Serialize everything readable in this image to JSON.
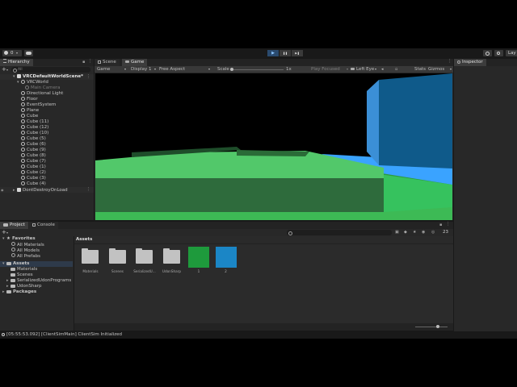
{
  "toolbar": {
    "account_label": "0",
    "layout_label": "Lay",
    "play_icon": "▶",
    "pause_icon": "❚❚",
    "step_icon": "▶❚"
  },
  "hierarchy": {
    "tab_label": "Hierarchy",
    "search_placeholder": "All",
    "scene_name": "VRCDefaultWorldScene*",
    "items": [
      {
        "label": "VRCWorld",
        "depth": 1,
        "expanded": true
      },
      {
        "label": "Main Camera",
        "depth": 2,
        "dimmed": true
      },
      {
        "label": "Directional Light",
        "depth": 1
      },
      {
        "label": "Floor",
        "depth": 1
      },
      {
        "label": "EventSystem",
        "depth": 1
      },
      {
        "label": "Plane",
        "depth": 1
      },
      {
        "label": "Cube",
        "depth": 1
      },
      {
        "label": "Cube (11)",
        "depth": 1
      },
      {
        "label": "Cube (12)",
        "depth": 1
      },
      {
        "label": "Cube (10)",
        "depth": 1
      },
      {
        "label": "Cube (5)",
        "depth": 1
      },
      {
        "label": "Cube (6)",
        "depth": 1
      },
      {
        "label": "Cube (9)",
        "depth": 1
      },
      {
        "label": "Cube (8)",
        "depth": 1
      },
      {
        "label": "Cube (7)",
        "depth": 1
      },
      {
        "label": "Cube (1)",
        "depth": 1
      },
      {
        "label": "Cube (2)",
        "depth": 1
      },
      {
        "label": "Cube (3)",
        "depth": 1
      },
      {
        "label": "Cube (4)",
        "depth": 1
      }
    ],
    "dont_destroy": "DontDestroyOnLoad"
  },
  "scene_tabs": {
    "scene": "Scene",
    "game": "Game"
  },
  "game_toolbar": {
    "mode": "Game",
    "display": "Display 1",
    "aspect": "Free Aspect",
    "scale_label": "Scale",
    "scale_value": "1x",
    "play_focused": "Play Focused",
    "eye": "Left Eye",
    "stats": "Stats",
    "gizmos": "Gizmos"
  },
  "inspector": {
    "tab_label": "Inspector"
  },
  "bottom_tabs": {
    "project": "Project",
    "console": "Console"
  },
  "project": {
    "count_badge": "23",
    "favorites_label": "Favorites",
    "favorites": [
      "All Materials",
      "All Models",
      "All Prefabs"
    ],
    "assets_label": "Assets",
    "asset_folders": [
      "Materials",
      "Scenes",
      "SerializedUdonPrograms",
      "UdonSharp"
    ],
    "packages_label": "Packages",
    "breadcrumb": "Assets",
    "grid": [
      {
        "label": "Materials",
        "kind": "folder"
      },
      {
        "label": "Scenes",
        "kind": "folder"
      },
      {
        "label": "SerializedU...",
        "kind": "folder"
      },
      {
        "label": "UdonSharp",
        "kind": "folder"
      },
      {
        "label": "1",
        "kind": "material",
        "color": "#1e9a3c"
      },
      {
        "label": "2",
        "kind": "material",
        "color": "#1b86c6"
      }
    ]
  },
  "status": {
    "message": "[05:55:53.092] [ClientSimMain] ClientSim Initialized"
  }
}
